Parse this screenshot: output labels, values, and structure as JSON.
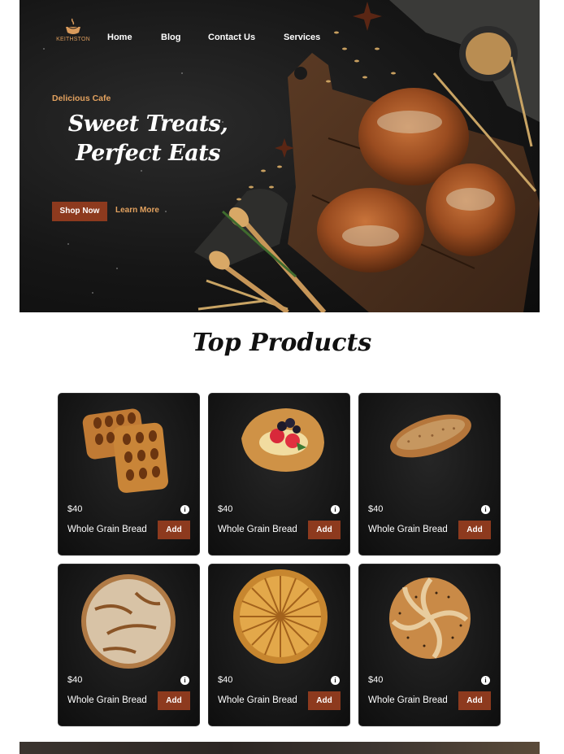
{
  "brand": {
    "logo_text": "KEITHSTON"
  },
  "nav": {
    "items": [
      {
        "label": "Home"
      },
      {
        "label": "Blog"
      },
      {
        "label": "Contact Us"
      },
      {
        "label": "Services"
      }
    ]
  },
  "hero": {
    "eyebrow": "Delicious Cafe",
    "headline_line1": "Sweet Treats,",
    "headline_line2": "Perfect Eats",
    "shop_label": "Shop Now",
    "learn_label": "Learn More"
  },
  "products_section": {
    "title": "Top Products",
    "items": [
      {
        "price": "$40",
        "name": "Whole Grain Bread",
        "add_label": "Add",
        "image": "lattice-pastry"
      },
      {
        "price": "$40",
        "name": "Whole Grain Bread",
        "add_label": "Add",
        "image": "berry-danish"
      },
      {
        "price": "$40",
        "name": "Whole Grain Bread",
        "add_label": "Add",
        "image": "baguette-loaf"
      },
      {
        "price": "$40",
        "name": "Whole Grain Bread",
        "add_label": "Add",
        "image": "round-sourdough"
      },
      {
        "price": "$40",
        "name": "Whole Grain Bread",
        "add_label": "Add",
        "image": "sliced-pie"
      },
      {
        "price": "$40",
        "name": "Whole Grain Bread",
        "add_label": "Add",
        "image": "seeded-kaiser-roll"
      }
    ]
  },
  "colors": {
    "accent": "#8d3a1e",
    "eyebrow": "#e3a25f",
    "hero_bg": "#161616",
    "card_bg": "#151515"
  }
}
